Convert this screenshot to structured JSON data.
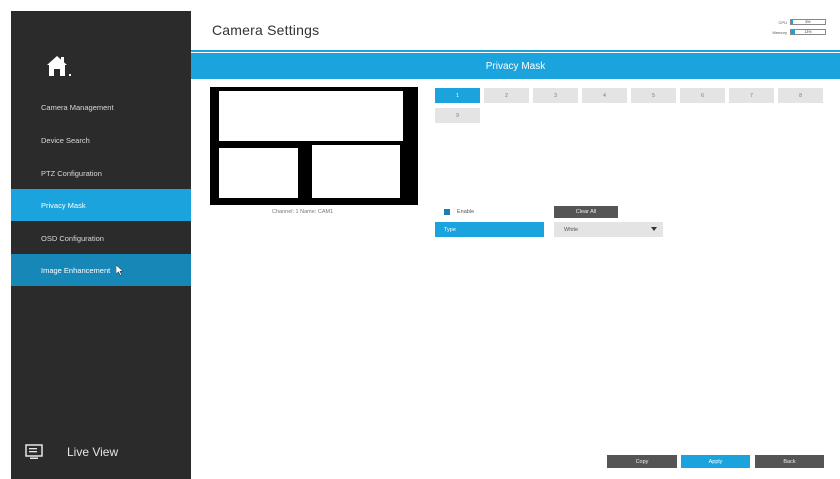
{
  "sidebar": {
    "items": [
      {
        "label": "Camera Management"
      },
      {
        "label": "Device Search"
      },
      {
        "label": "PTZ Configuration"
      },
      {
        "label": "Privacy Mask"
      },
      {
        "label": "OSD Configuration"
      },
      {
        "label": "Image Enhancement"
      }
    ],
    "live_view_label": "Live View"
  },
  "header": {
    "title": "Camera Settings",
    "cpu_label": "CPU",
    "cpu_value": "6%",
    "cpu_fraction": 0.06,
    "memory_label": "Memory",
    "memory_value": "13%",
    "memory_fraction": 0.13
  },
  "banner": {
    "title": "Privacy Mask"
  },
  "preview": {
    "caption": "Channel: 1    Name: CAM1"
  },
  "mask_tabs": [
    "1",
    "2",
    "3",
    "4",
    "5",
    "6",
    "7",
    "8",
    "9"
  ],
  "controls": {
    "enable_label": "Enable",
    "clear_all_label": "Clear All",
    "type_label": "Type",
    "type_value": "White"
  },
  "footer": {
    "copy_label": "Copy",
    "apply_label": "Apply",
    "back_label": "Back"
  },
  "colors": {
    "accent": "#1aa3dc",
    "sidebar": "#2b2b2b"
  },
  "icons": {
    "home": "home-icon",
    "live_view": "monitor-icon"
  }
}
